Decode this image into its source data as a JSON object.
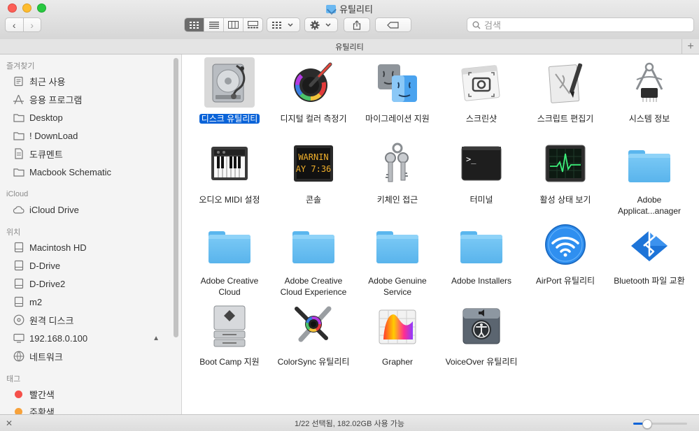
{
  "window": {
    "title": "유틸리티"
  },
  "toolbar": {
    "back_glyph": "‹",
    "forward_glyph": "›",
    "search_placeholder": "검색"
  },
  "pathbar": {
    "label": "유틸리티",
    "plus": "+"
  },
  "sidebar": {
    "favorites_header": "즐겨찾기",
    "favorites": [
      {
        "label": "최근 사용",
        "icon": "recents-icon"
      },
      {
        "label": "응용 프로그램",
        "icon": "applications-icon"
      },
      {
        "label": "Desktop",
        "icon": "folder-icon"
      },
      {
        "label": "! DownLoad",
        "icon": "folder-icon"
      },
      {
        "label": "도큐멘트",
        "icon": "documents-icon"
      },
      {
        "label": "Macbook Schematic",
        "icon": "folder-icon"
      }
    ],
    "icloud_header": "iCloud",
    "icloud": [
      {
        "label": "iCloud Drive",
        "icon": "cloud-icon"
      }
    ],
    "locations_header": "위치",
    "locations": [
      {
        "label": "Macintosh HD",
        "icon": "disk-icon"
      },
      {
        "label": "D-Drive",
        "icon": "disk-icon"
      },
      {
        "label": "D-Drive2",
        "icon": "disk-icon"
      },
      {
        "label": "m2",
        "icon": "disk-icon"
      },
      {
        "label": "원격 디스크",
        "icon": "optical-disc-icon"
      },
      {
        "label": "192.168.0.100",
        "icon": "display-icon"
      },
      {
        "label": "네트워크",
        "icon": "network-icon"
      }
    ],
    "tags_header": "태그",
    "tags": [
      {
        "label": "빨간색",
        "color": "#f5504a"
      },
      {
        "label": "주황색",
        "color": "#f7a23b"
      }
    ]
  },
  "files": [
    {
      "label": "디스크 유틸리티",
      "icon": "disk-utility-icon",
      "selected": true
    },
    {
      "label": "디지털 컬러 측정기",
      "icon": "color-meter-icon"
    },
    {
      "label": "마이그레이션 지원",
      "icon": "migration-icon"
    },
    {
      "label": "스크린샷",
      "icon": "screenshot-icon"
    },
    {
      "label": "스크립트 편집기",
      "icon": "script-editor-icon"
    },
    {
      "label": "시스템 정보",
      "icon": "system-info-icon"
    },
    {
      "label": "오디오 MIDI 설정",
      "icon": "midi-icon"
    },
    {
      "label": "콘솔",
      "icon": "console-icon",
      "console_text_1": "WARNIN",
      "console_text_2": "AY 7:36"
    },
    {
      "label": "키체인 접근",
      "icon": "keychain-icon"
    },
    {
      "label": "터미널",
      "icon": "terminal-icon",
      "prompt": ">_"
    },
    {
      "label": "활성 상태 보기",
      "icon": "activity-monitor-icon"
    },
    {
      "label": "Adobe Applicat...anager",
      "icon": "folder-icon"
    },
    {
      "label": "Adobe Creative Cloud",
      "icon": "folder-icon"
    },
    {
      "label": "Adobe Creative Cloud Experience",
      "icon": "folder-icon"
    },
    {
      "label": "Adobe Genuine Service",
      "icon": "folder-icon"
    },
    {
      "label": "Adobe Installers",
      "icon": "folder-icon"
    },
    {
      "label": "AirPort 유틸리티",
      "icon": "airport-icon"
    },
    {
      "label": "Bluetooth 파일 교환",
      "icon": "bluetooth-icon"
    },
    {
      "label": "Boot Camp 지원",
      "icon": "bootcamp-icon"
    },
    {
      "label": "ColorSync 유틸리티",
      "icon": "colorsync-icon"
    },
    {
      "label": "Grapher",
      "icon": "grapher-icon"
    },
    {
      "label": "VoiceOver 유틸리티",
      "icon": "voiceover-icon"
    }
  ],
  "status": {
    "text": "1/22 선택됨, 182.02GB 사용 가능",
    "zoom_level": 0.25
  },
  "colors": {
    "accent": "#0a63d8",
    "folder": "#6bc0f2"
  }
}
